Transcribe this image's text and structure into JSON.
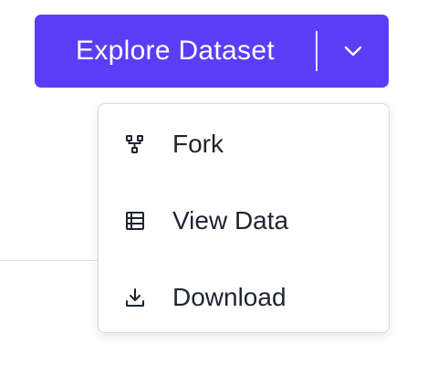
{
  "button": {
    "label": "Explore Dataset",
    "toggle_icon": "chevron-down-icon",
    "color": "#5b3df5"
  },
  "menu": {
    "items": [
      {
        "label": "Fork",
        "icon": "fork-icon"
      },
      {
        "label": "View Data",
        "icon": "table-icon"
      },
      {
        "label": "Download",
        "icon": "download-icon"
      }
    ]
  }
}
